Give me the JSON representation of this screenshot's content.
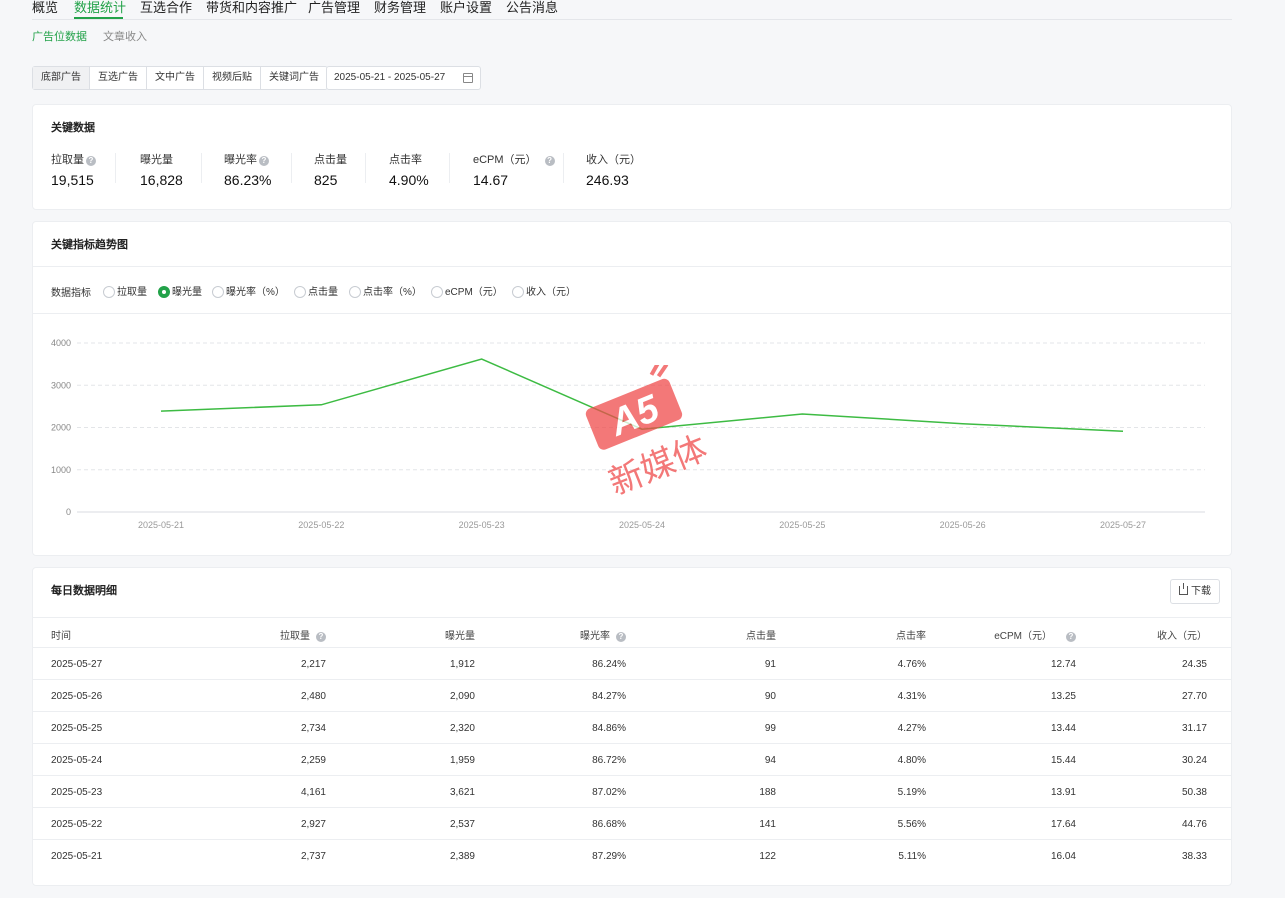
{
  "topnav": {
    "items": [
      "概览",
      "数据统计",
      "互选合作",
      "带货和内容推广",
      "广告管理",
      "财务管理",
      "账户设置",
      "公告消息"
    ],
    "active_index": 1
  },
  "subnav": {
    "items": [
      "广告位数据",
      "文章收入"
    ],
    "active_index": 0
  },
  "ad_tabs": {
    "items": [
      "底部广告",
      "互选广告",
      "文中广告",
      "视频后贴",
      "关键词广告"
    ],
    "active_index": 0
  },
  "date_range": "2025-05-21 - 2025-05-27",
  "key_data": {
    "title": "关键数据",
    "items": [
      {
        "label": "拉取量",
        "value": "19,515",
        "help": true
      },
      {
        "label": "曝光量",
        "value": "16,828",
        "help": false
      },
      {
        "label": "曝光率",
        "value": "86.23%",
        "help": true
      },
      {
        "label": "点击量",
        "value": "825",
        "help": false
      },
      {
        "label": "点击率",
        "value": "4.90%",
        "help": false
      },
      {
        "label": "eCPM（元）",
        "value": "14.67",
        "help": true
      },
      {
        "label": "收入（元）",
        "value": "246.93",
        "help": false
      }
    ]
  },
  "trend": {
    "title": "关键指标趋势图",
    "metric_label": "数据指标",
    "options": [
      "拉取量",
      "曝光量",
      "曝光率（%）",
      "点击量",
      "点击率（%）",
      "eCPM（元）",
      "收入（元）"
    ],
    "selected_index": 1
  },
  "chart_data": {
    "type": "line",
    "title": "",
    "x": [
      "2025-05-21",
      "2025-05-22",
      "2025-05-23",
      "2025-05-24",
      "2025-05-25",
      "2025-05-26",
      "2025-05-27"
    ],
    "series": [
      {
        "name": "曝光量",
        "values": [
          2389,
          2537,
          3621,
          1959,
          2320,
          2090,
          1912
        ]
      }
    ],
    "yticks": [
      0,
      1000,
      2000,
      3000,
      4000
    ],
    "ylim": [
      0,
      4000
    ],
    "grid": true,
    "color": "#3dbb43"
  },
  "daily": {
    "title": "每日数据明细",
    "download_label": "下载",
    "columns": [
      {
        "label": "时间",
        "help": false
      },
      {
        "label": "拉取量",
        "help": true
      },
      {
        "label": "曝光量",
        "help": false
      },
      {
        "label": "曝光率",
        "help": true
      },
      {
        "label": "点击量",
        "help": false
      },
      {
        "label": "点击率",
        "help": false
      },
      {
        "label": "eCPM（元）",
        "help": true
      },
      {
        "label": "收入（元）",
        "help": false
      }
    ],
    "rows": [
      [
        "2025-05-27",
        "2,217",
        "1,912",
        "86.24%",
        "91",
        "4.76%",
        "12.74",
        "24.35"
      ],
      [
        "2025-05-26",
        "2,480",
        "2,090",
        "84.27%",
        "90",
        "4.31%",
        "13.25",
        "27.70"
      ],
      [
        "2025-05-25",
        "2,734",
        "2,320",
        "84.86%",
        "99",
        "4.27%",
        "13.44",
        "31.17"
      ],
      [
        "2025-05-24",
        "2,259",
        "1,959",
        "86.72%",
        "94",
        "4.80%",
        "15.44",
        "30.24"
      ],
      [
        "2025-05-23",
        "4,161",
        "3,621",
        "87.02%",
        "188",
        "5.19%",
        "13.91",
        "50.38"
      ],
      [
        "2025-05-22",
        "2,927",
        "2,537",
        "86.68%",
        "141",
        "5.56%",
        "17.64",
        "44.76"
      ],
      [
        "2025-05-21",
        "2,737",
        "2,389",
        "87.29%",
        "122",
        "5.11%",
        "16.04",
        "38.33"
      ]
    ]
  },
  "watermark": {
    "logo_text": "A5",
    "text": "新媒体",
    "color": "#ee3333"
  },
  "colors": {
    "accent": "#22a249",
    "line": "#3dbb43"
  }
}
